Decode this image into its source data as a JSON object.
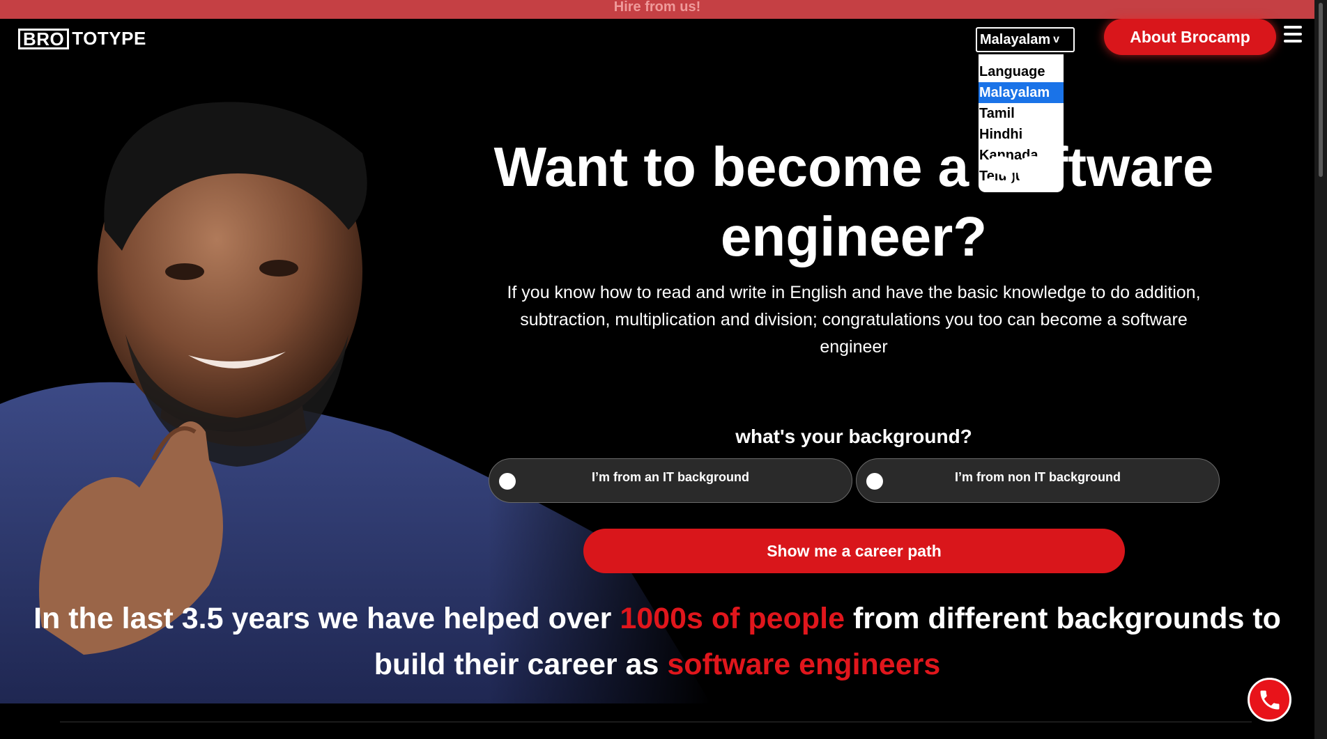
{
  "topbar": {
    "text": "Hire from us!"
  },
  "logo": {
    "boxed": "BRO",
    "rest": "TOTYPE"
  },
  "language": {
    "selected": "Malayalam",
    "chevron": "v",
    "options": [
      "Language",
      "Malayalam",
      "Tamil",
      "Hindhi",
      "Kannada",
      "Telugu"
    ]
  },
  "nav": {
    "about_label": "About Brocamp",
    "menu_icon": "hamburger-icon"
  },
  "hero": {
    "title_line1": "Want to become a software",
    "title_line2": "engineer?",
    "subtitle": "If you know how to read and write in English and have the basic knowledge to do addition, subtraction, multiplication and division; congratulations you too can become a software engineer"
  },
  "background": {
    "question": "what's your background?",
    "option_it": "I’m from an IT background",
    "option_non_it": "I’m from non IT background"
  },
  "cta": {
    "label": "Show me a career path"
  },
  "stats": {
    "part1": "In the last 3.5 years we have helped over ",
    "highlight1": "1000s of people",
    "part2": " from different backgrounds to build their career as ",
    "highlight2": "software engineers"
  },
  "colors": {
    "brand_red": "#d9161b",
    "topbar": "#c54044",
    "highlight": "#e0161c"
  },
  "call": {
    "icon": "phone-icon"
  }
}
